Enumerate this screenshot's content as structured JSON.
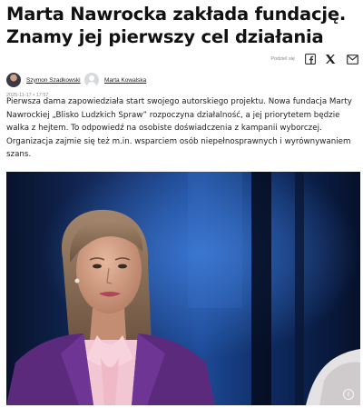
{
  "article": {
    "headline": "Marta Nawrocka zakłada fundację. Znamy jej pierwszy cel działania",
    "authors": [
      {
        "name": "Szymon Szadkowski",
        "avatar": "author-photo-icon"
      },
      {
        "name": "Marta Kowalska",
        "avatar": "user-placeholder-icon"
      }
    ],
    "date": "2025-11-17  •  17:57",
    "lead": "Pierwsza dama zapowiedziała start swojego autorskiego projektu. Nowa fundacja Marty Nawrockiej „Blisko Ludzkich Spraw” rozpoczyna działalność, a jej priorytetem będzie walka z hejtem. To odpowiedź na osobiste doświadczenia z kampanii wyborczej. Organizacja zajmie się też m.in. wsparciem osób niepełnosprawnych i wyrównywaniem szans."
  },
  "share": {
    "label": "Podziel się",
    "icons": [
      "facebook-icon",
      "x-icon",
      "mail-icon"
    ]
  },
  "photo": {
    "icon": "info-icon",
    "info_glyph": "i"
  }
}
